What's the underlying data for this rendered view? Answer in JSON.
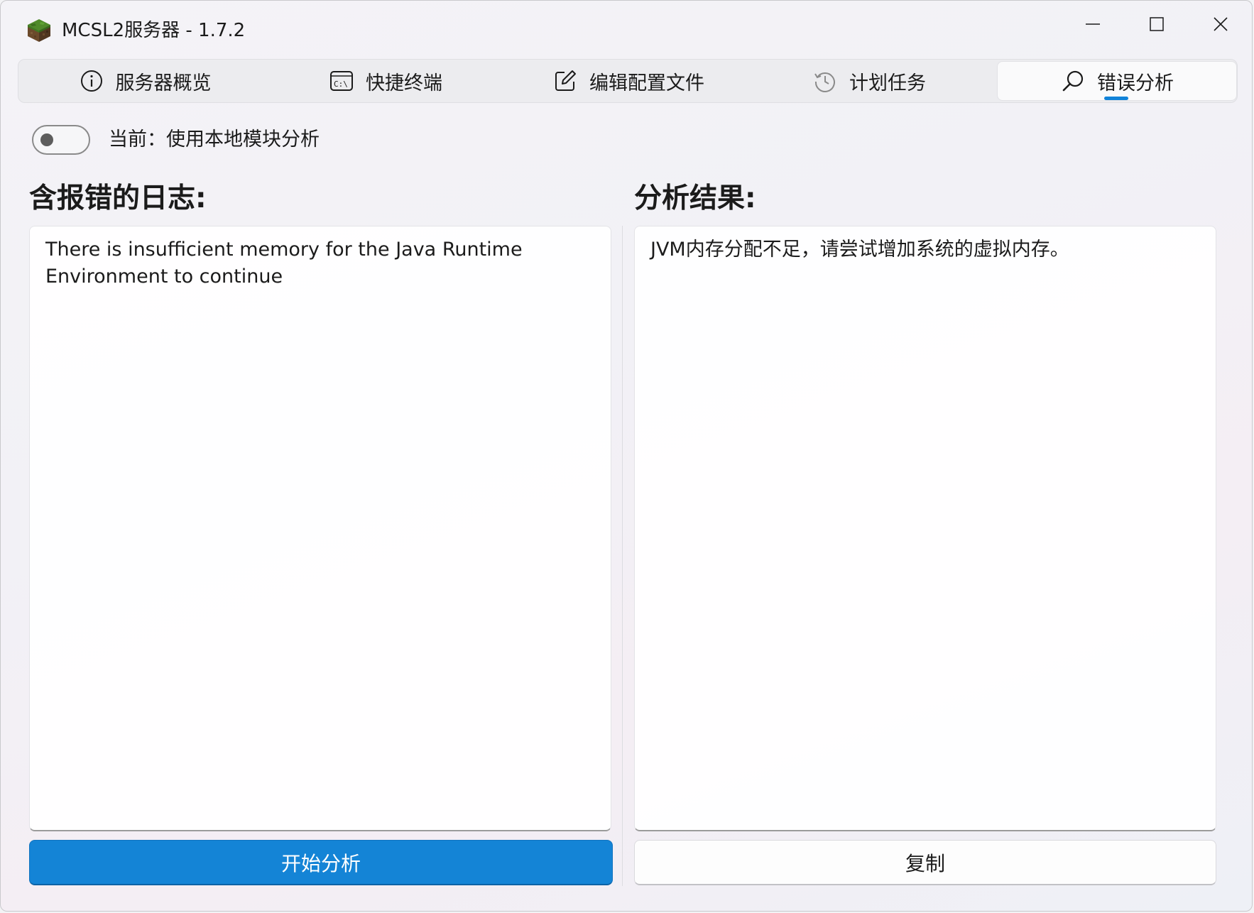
{
  "window": {
    "title": "MCSL2服务器 - 1.7.2",
    "app_icon": "grass-block-icon"
  },
  "window_controls": {
    "minimize_icon": "minimize-icon",
    "maximize_icon": "maximize-icon",
    "close_icon": "close-icon"
  },
  "tabs": [
    {
      "label": "服务器概览",
      "icon": "info-icon",
      "active": false
    },
    {
      "label": "快捷终端",
      "icon": "terminal-icon",
      "active": false
    },
    {
      "label": "编辑配置文件",
      "icon": "edit-icon",
      "active": false
    },
    {
      "label": "计划任务",
      "icon": "history-icon",
      "active": false
    },
    {
      "label": "错误分析",
      "icon": "search-icon",
      "active": true
    }
  ],
  "mode_toggle": {
    "checked": false,
    "label": "当前：使用本地模块分析"
  },
  "log_section": {
    "title": "含报错的日志:",
    "content": "There is insufficient memory for the Java Runtime Environment to continue"
  },
  "result_section": {
    "title": "分析结果:",
    "content": "JVM内存分配不足，请尝试增加系统的虚拟内存。"
  },
  "actions": {
    "analyze_label": "开始分析",
    "copy_label": "复制"
  },
  "colors": {
    "accent": "#1484d6",
    "indicator": "#1183d9"
  }
}
